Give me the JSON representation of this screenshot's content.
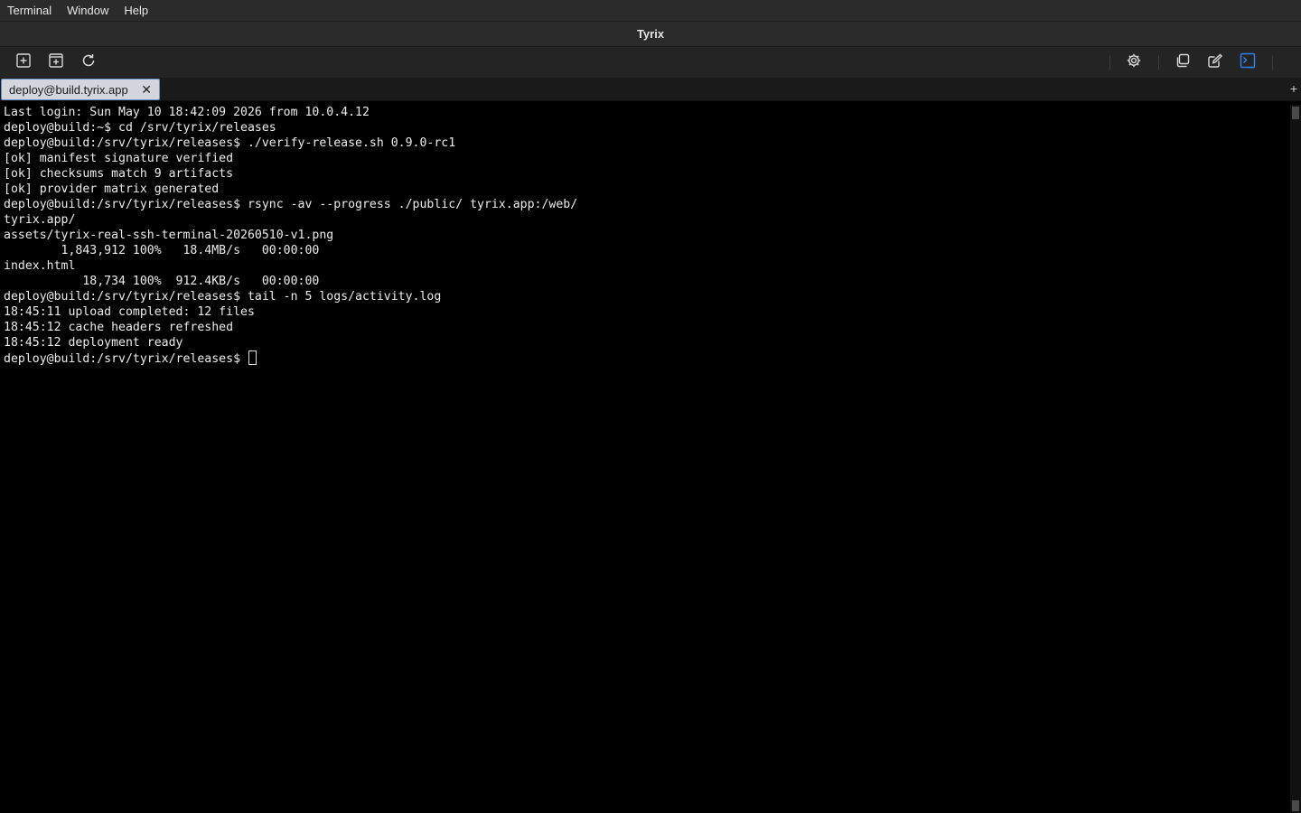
{
  "menubar": {
    "items": [
      "Terminal",
      "Window",
      "Help"
    ]
  },
  "window": {
    "title": "Tyrix"
  },
  "toolbar": {
    "left_icons": [
      "new-session-icon",
      "new-tab-icon",
      "refresh-icon"
    ],
    "right_icons": [
      "gear-icon",
      "copy-icon",
      "edit-icon",
      "terminal-icon"
    ],
    "accent_color": "#2f7fe8"
  },
  "tabs": [
    {
      "label": "deploy@build.tyrix.app",
      "close": "✕",
      "active": true
    }
  ],
  "new_tab_label": "+",
  "terminal": {
    "lines": [
      "Last login: Sun May 10 18:42:09 2026 from 10.0.4.12",
      "deploy@build:~$ cd /srv/tyrix/releases",
      "deploy@build:/srv/tyrix/releases$ ./verify-release.sh 0.9.0-rc1",
      "[ok] manifest signature verified",
      "[ok] checksums match 9 artifacts",
      "[ok] provider matrix generated",
      "deploy@build:/srv/tyrix/releases$ rsync -av --progress ./public/ tyrix.app:/web/",
      "tyrix.app/",
      "assets/tyrix-real-ssh-terminal-20260510-v1.png",
      "        1,843,912 100%   18.4MB/s   00:00:00",
      "index.html",
      "           18,734 100%  912.4KB/s   00:00:00",
      "deploy@build:/srv/tyrix/releases$ tail -n 5 logs/activity.log",
      "18:45:11 upload completed: 12 files",
      "18:45:12 cache headers refreshed",
      "18:45:12 deployment ready"
    ],
    "prompt": "deploy@build:/srv/tyrix/releases$ "
  }
}
